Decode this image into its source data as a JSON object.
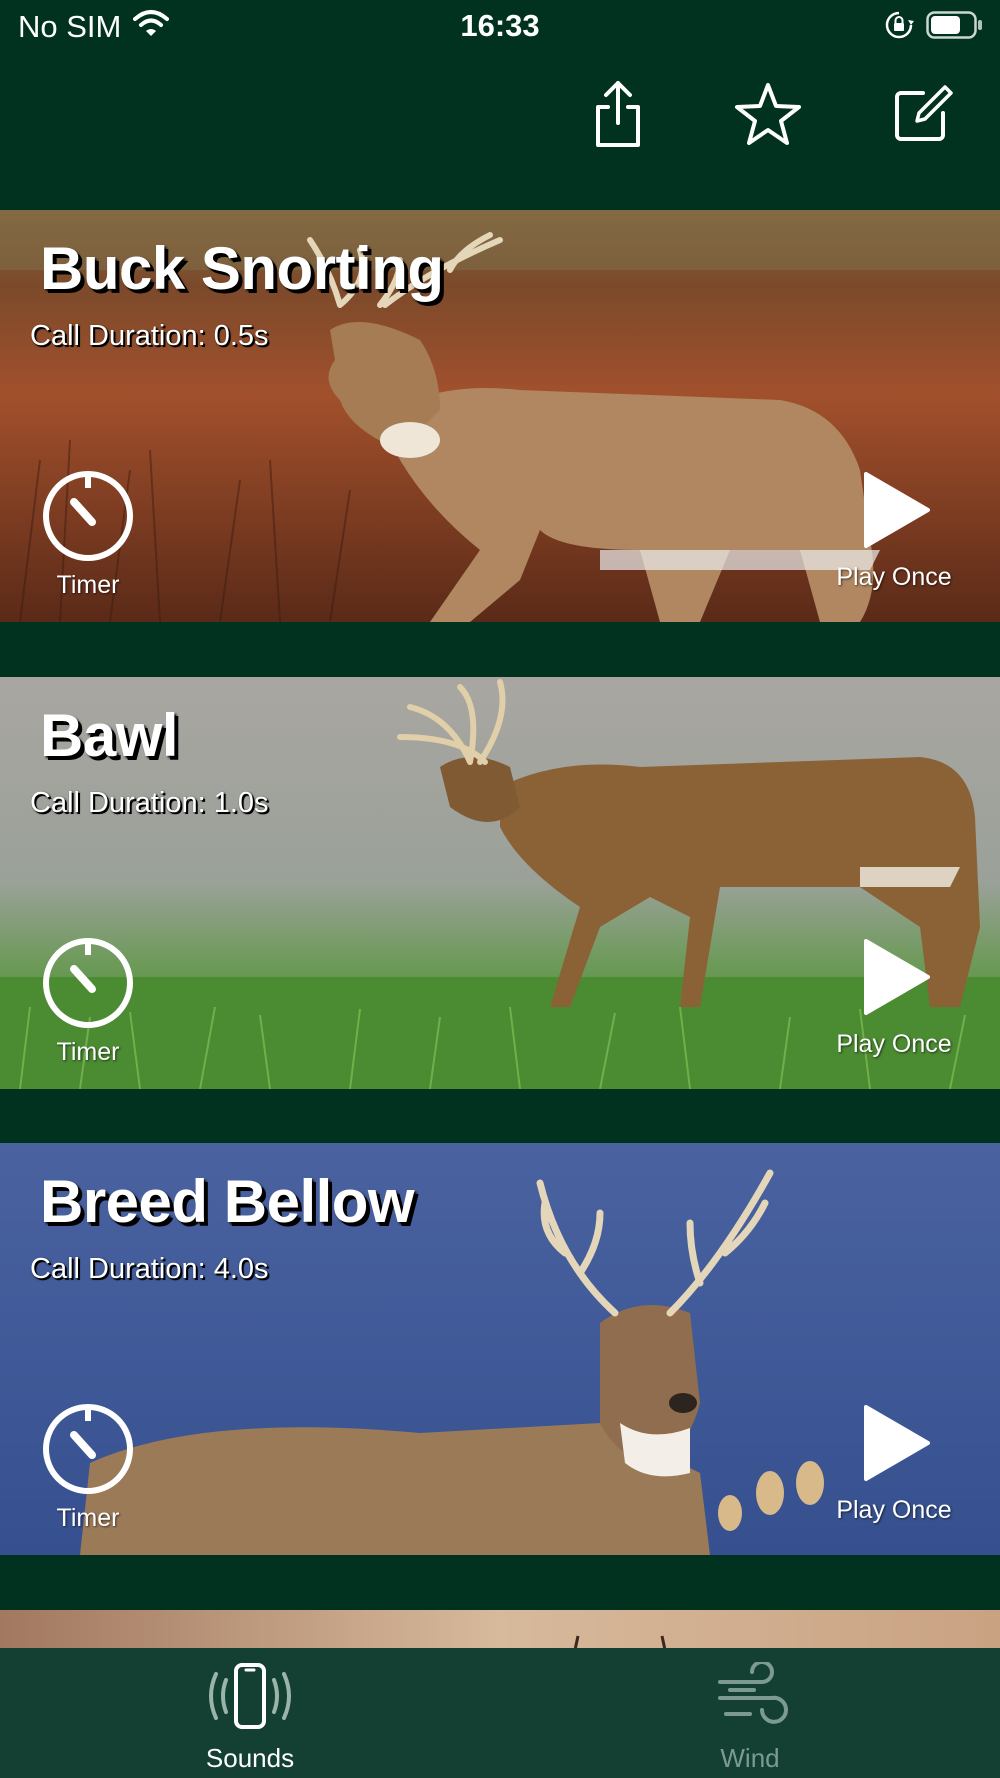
{
  "status_bar": {
    "carrier": "No SIM",
    "time": "16:33",
    "icons": [
      "wifi-icon",
      "orientation-lock-icon",
      "battery-icon"
    ]
  },
  "toolbar": {
    "buttons": [
      "share-icon",
      "star-icon",
      "edit-icon"
    ]
  },
  "calls": [
    {
      "title": "Buck Snorting",
      "duration": "Call Duration: 0.5s",
      "timer_label": "Timer",
      "play_label": "Play Once",
      "background": "autumn-field"
    },
    {
      "title": "Bawl",
      "duration": "Call Duration: 1.0s",
      "timer_label": "Timer",
      "play_label": "Play Once",
      "background": "grass-meadow"
    },
    {
      "title": "Breed Bellow",
      "duration": "Call Duration: 4.0s",
      "timer_label": "Timer",
      "play_label": "Play Once",
      "background": "blue-sky"
    }
  ],
  "tabs": [
    {
      "label": "Sounds",
      "icon": "phone-vibrate-icon",
      "active": true
    },
    {
      "label": "Wind",
      "icon": "wind-icon",
      "active": false
    }
  ],
  "colors": {
    "background": "#013220",
    "tab_bar": "#143f33",
    "tab_inactive": "#7d9a90",
    "text": "#ffffff"
  }
}
